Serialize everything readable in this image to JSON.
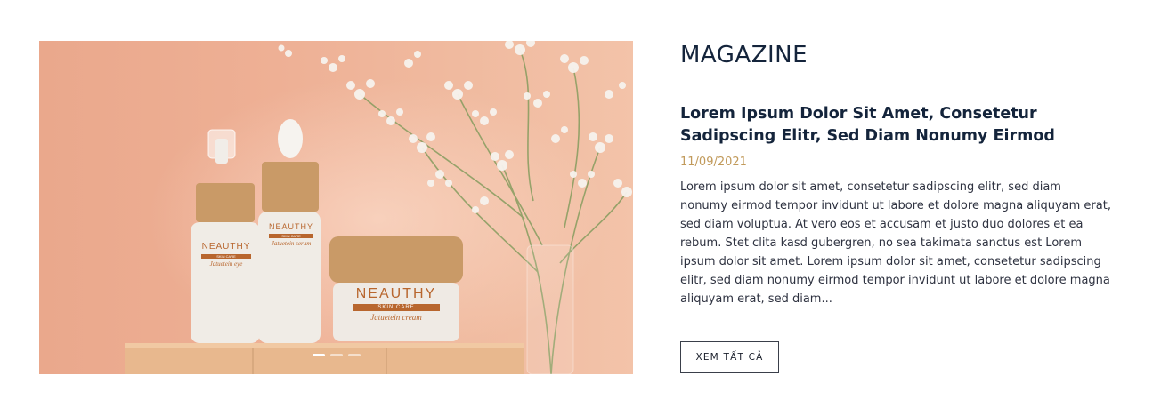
{
  "section": {
    "title": "MAGAZINE"
  },
  "post": {
    "title": "Lorem Ipsum Dolor Sit Amet, Consetetur Sadipscing Elitr, Sed Diam Nonumy Eirmod",
    "date": "11/09/2021",
    "excerpt": "Lorem ipsum dolor sit amet, consetetur sadipscing elitr, sed diam nonumy eirmod tempor invidunt ut labore et dolore magna aliquyam erat, sed diam voluptua. At vero eos et accusam et justo duo dolores et ea rebum. Stet clita kasd gubergren, no sea takimata sanctus est Lorem ipsum dolor sit amet. Lorem ipsum dolor sit amet, consetetur sadipscing elitr, sed diam nonumy eirmod tempor invidunt ut labore et dolore magna aliquyam erat, sed diam..."
  },
  "cta": {
    "label": "XEM TẤT CẢ"
  },
  "hero_image": {
    "products": [
      {
        "brand": "NEAUTHY",
        "line": "SKIN CARE",
        "name": "Jatuetein eye"
      },
      {
        "brand": "NEAUTHY",
        "line": "SKIN CARE",
        "name": "Jatuetein serum"
      },
      {
        "brand": "NEAUTHY",
        "line": "SKIN CARE",
        "name": "Jatuetein cream"
      }
    ],
    "slides_total": 3,
    "slide_active": 1
  },
  "colors": {
    "heading": "#14243b",
    "date": "#c19a5b",
    "body_text": "#2e3240",
    "background_peach": "#eeb095",
    "label_brown": "#b8662e"
  }
}
